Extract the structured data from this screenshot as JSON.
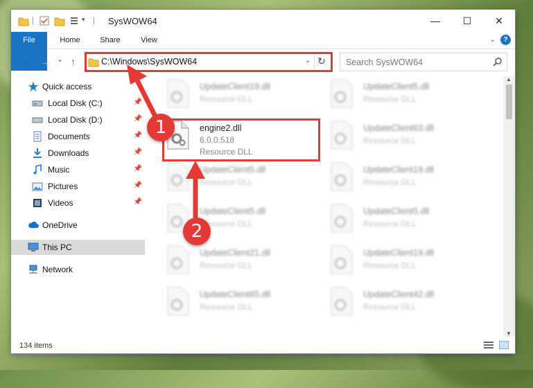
{
  "window": {
    "title": "SysWOW64",
    "minimize": "—",
    "maximize": "☐",
    "close": "✕"
  },
  "ribbon": {
    "tabs": [
      "File",
      "Home",
      "Share",
      "View"
    ],
    "help": "?"
  },
  "nav": {
    "back": "←",
    "forward": "→",
    "recent": "⌄",
    "up": "↑",
    "address": "C:\\Windows\\SysWOW64",
    "refresh": "↻",
    "search_placeholder": "Search SysWOW64"
  },
  "sidebar": {
    "items": [
      {
        "label": "Quick access",
        "icon": "star-icon",
        "pinned": false
      },
      {
        "label": "Local Disk (C:)",
        "icon": "drive-icon",
        "pinned": true
      },
      {
        "label": "Local Disk (D:)",
        "icon": "drive-icon",
        "pinned": true
      },
      {
        "label": "Documents",
        "icon": "documents-icon",
        "pinned": true
      },
      {
        "label": "Downloads",
        "icon": "download-icon",
        "pinned": true
      },
      {
        "label": "Music",
        "icon": "music-icon",
        "pinned": true
      },
      {
        "label": "Pictures",
        "icon": "pictures-icon",
        "pinned": true
      },
      {
        "label": "Videos",
        "icon": "videos-icon",
        "pinned": true
      },
      {
        "label": "OneDrive",
        "icon": "cloud-icon",
        "pinned": false
      },
      {
        "label": "This PC",
        "icon": "computer-icon",
        "pinned": false,
        "selected": true
      },
      {
        "label": "Network",
        "icon": "network-icon",
        "pinned": false
      }
    ]
  },
  "files": {
    "highlighted": {
      "name": "engine2.dll",
      "version": "6.0.0.518",
      "type": "Resource DLL"
    },
    "left_column": [
      {
        "name": "UpdateClient19.dll",
        "type": "Resource DLL"
      },
      {
        "name": "UpdateClient5.dll",
        "type": "Resource DLL"
      },
      {
        "name": "UpdateClient5.dll",
        "type": "Resource DLL"
      },
      {
        "name": "UpdateClient21.dll",
        "type": "Resource DLL"
      },
      {
        "name": "UpdateClient65.dll",
        "type": "Resource DLL"
      }
    ],
    "right_column": [
      {
        "name": "UpdateClient5.dll",
        "type": "Resource DLL"
      },
      {
        "name": "UpdateClient63.dll",
        "type": "Resource DLL"
      },
      {
        "name": "UpdateClient19.dll",
        "type": "Resource DLL"
      },
      {
        "name": "UpdateClient5.dll",
        "type": "Resource DLL"
      },
      {
        "name": "UpdateClient19.dll",
        "type": "Resource DLL"
      },
      {
        "name": "UpdateClient42.dll",
        "type": "Resource DLL"
      }
    ]
  },
  "status": {
    "item_count": "134 items"
  },
  "annotations": {
    "step1": "1",
    "step2": "2",
    "color": "#e53935"
  }
}
